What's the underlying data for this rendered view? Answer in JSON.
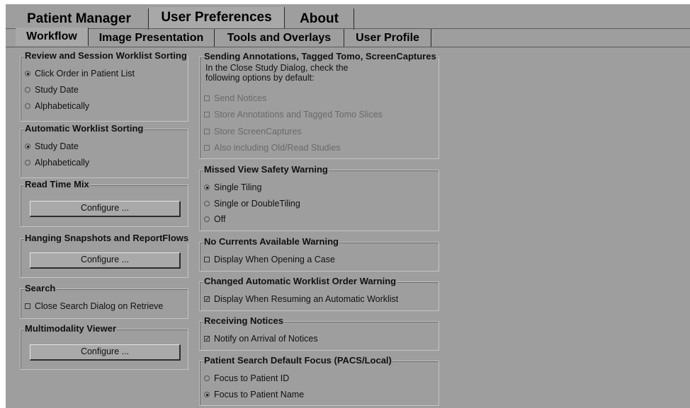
{
  "tabs_top": [
    {
      "label": "Patient Manager"
    },
    {
      "label": "User Preferences"
    },
    {
      "label": "About"
    }
  ],
  "tabs_sub": [
    {
      "label": "Workflow"
    },
    {
      "label": "Image Presentation"
    },
    {
      "label": "Tools and Overlays"
    },
    {
      "label": "User Profile"
    }
  ],
  "review_sorting": {
    "title": "Review and Session Worklist Sorting",
    "options": [
      {
        "label": "Click Order in Patient List",
        "selected": true
      },
      {
        "label": "Study Date",
        "selected": false
      },
      {
        "label": "Alphabetically",
        "selected": false
      }
    ]
  },
  "auto_sorting": {
    "title": "Automatic Worklist Sorting",
    "options": [
      {
        "label": "Study Date",
        "selected": true
      },
      {
        "label": "Alphabetically",
        "selected": false
      }
    ]
  },
  "read_time_mix": {
    "title": "Read Time Mix",
    "button": "Configure ..."
  },
  "hanging": {
    "title": "Hanging Snapshots and ReportFlows",
    "button": "Configure ..."
  },
  "search": {
    "title": "Search",
    "checkbox": {
      "label": "Close Search Dialog on Retrieve",
      "checked": false
    }
  },
  "multimodality": {
    "title": "Multimodality Viewer",
    "button": "Configure ..."
  },
  "sending": {
    "title": "Sending Annotations, Tagged Tomo, ScreenCaptures",
    "note_line1": "In the Close Study Dialog, check the",
    "note_line2": "following options by default:",
    "options": [
      {
        "label": "Send Notices",
        "checked": false
      },
      {
        "label": "Store Annotations and Tagged Tomo Slices",
        "checked": false
      },
      {
        "label": "Store ScreenCaptures",
        "checked": false
      },
      {
        "label": "Also including Old/Read Studies",
        "checked": false
      }
    ]
  },
  "missed_view": {
    "title": "Missed View Safety Warning",
    "options": [
      {
        "label": "Single Tiling",
        "selected": true
      },
      {
        "label": "Single or DoubleTiling",
        "selected": false
      },
      {
        "label": "Off",
        "selected": false
      }
    ]
  },
  "no_currents": {
    "title": "No Currents Available Warning",
    "checkbox": {
      "label": "Display When Opening a Case",
      "checked": false
    }
  },
  "changed_auto": {
    "title": "Changed Automatic Worklist Order Warning",
    "checkbox": {
      "label": "Display When Resuming an Automatic Worklist",
      "checked": true
    }
  },
  "receiving": {
    "title": "Receiving Notices",
    "checkbox": {
      "label": "Notify on Arrival of Notices",
      "checked": true
    }
  },
  "patient_search": {
    "title": "Patient Search Default Focus (PACS/Local)",
    "options": [
      {
        "label": "Focus to Patient ID",
        "selected": false
      },
      {
        "label": "Focus to Patient Name",
        "selected": true
      }
    ]
  },
  "colors": {
    "panel_bg": "#9e9e9e",
    "active_tab_bg": "#a8a8a8",
    "text": "#111111",
    "disabled_text": "#6a6a6a"
  }
}
